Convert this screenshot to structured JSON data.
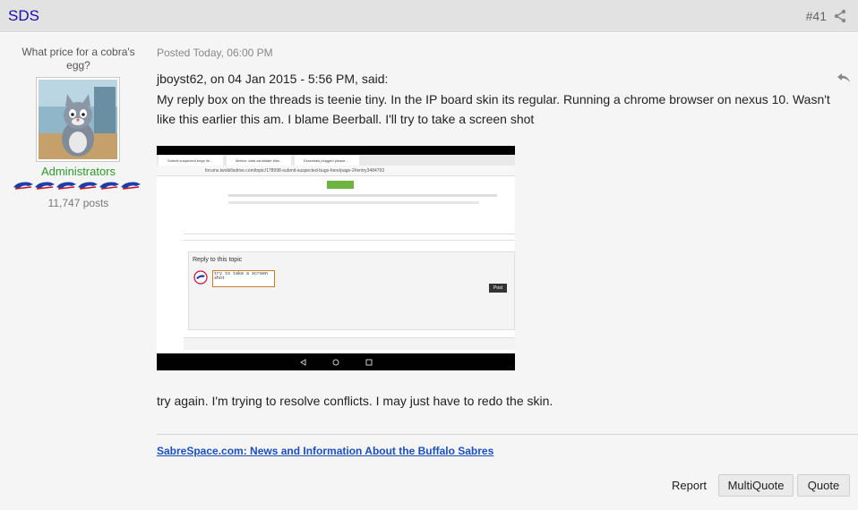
{
  "header": {
    "author": "SDS",
    "post_number": "#41"
  },
  "author_panel": {
    "member_title": "What price for a cobra's egg?",
    "group": "Administrators",
    "post_count": "11,747 posts"
  },
  "post": {
    "date": "Posted Today, 06:00 PM",
    "citation": "jboyst62, on 04 Jan 2015 - 5:56 PM, said:",
    "quoted_text": "My reply box on the threads is teenie tiny. In the IP board skin its regular. Running a chrome browser on nexus 10. Wasn't like this earlier this am. I blame Beerball. I'll try to take a screen shot",
    "followup": "try again. I'm trying to resolve conflicts. I may just have to redo the skin.",
    "signature_link": "SabreSpace.com: News and Information About the Buffalo Sabres"
  },
  "actions": {
    "report": "Report",
    "multiquote": "MultiQuote",
    "quote": "Quote"
  },
  "embedded_screenshot": {
    "tabs": [
      "Submit suspected bugs he...",
      "Melton: data candidate Max...",
      "Essentials plugged please..."
    ],
    "url": "forums.twobillsdrive.com/topic/178998-submit-suspected-bugs-here/page-2#entry3484793",
    "reply_title": "Reply to this topic",
    "reply_text": "try to take a screen\nshot",
    "post_button": "Post"
  },
  "colors": {
    "header_bg": "#e2e2e2",
    "panel_bg": "#f5f5f5",
    "author_link": "#1a0dab",
    "group_color": "#2b9a2b",
    "signature_link": "#1a4fbf"
  },
  "icons": [
    "share-icon",
    "reply-icon",
    "buffalo-pip-icon"
  ]
}
